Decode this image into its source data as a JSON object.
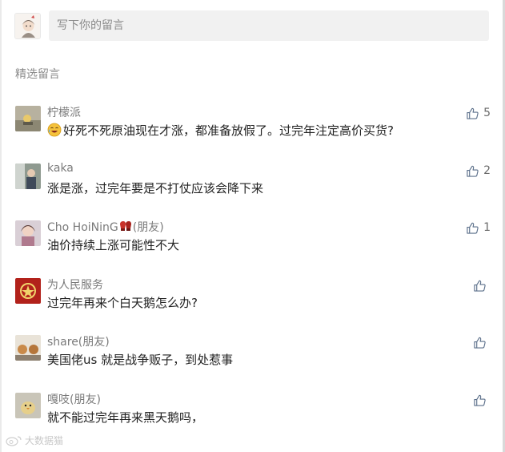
{
  "compose": {
    "placeholder": "写下你的留言"
  },
  "section_title": "精选留言",
  "comments": [
    {
      "name": "柠檬派",
      "text": "好死不死原油现在才涨，都准备放假了。过完年注定高价买货?",
      "likes": "5",
      "has_emoji": true
    },
    {
      "name": "kaka",
      "text": "涨是涨，过完年要是不打仗应该会降下来",
      "likes": "2"
    },
    {
      "name": "Cho HoiNinG",
      "suffix": "(朋友)",
      "text": "油价持续上涨可能性不大",
      "likes": "1",
      "has_badge": true
    },
    {
      "name": "为人民服务",
      "text": "过完年再来个白天鹅怎么办?",
      "likes": ""
    },
    {
      "name": "share(朋友)",
      "text": "美国佬us 就是战争贩子，到处惹事",
      "likes": ""
    },
    {
      "name": "嘎吱(朋友)",
      "text": "就不能过完年再来黑天鹅吗，",
      "likes": ""
    }
  ],
  "watermark": "大数据猫",
  "colors": {
    "placeholder_bg": "#f1f1f1",
    "muted_text": "#8a8a8a",
    "body_text": "#222222"
  }
}
